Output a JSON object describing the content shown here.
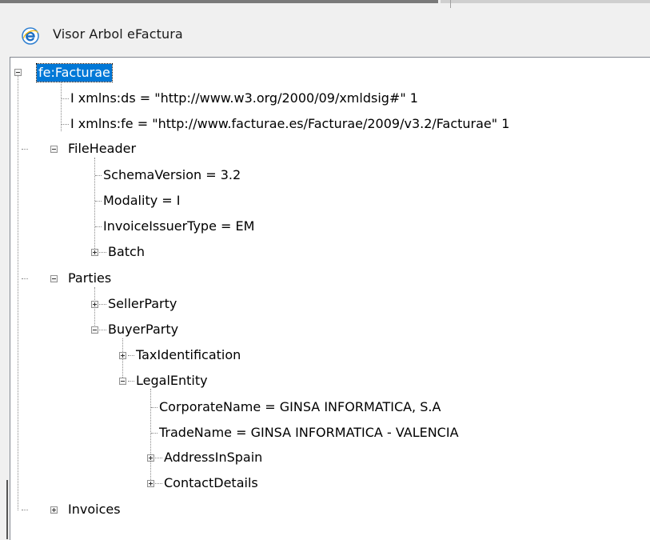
{
  "window": {
    "title": "Visor Arbol eFactura",
    "icon": "ie-e-icon",
    "accent": "#0078d7"
  },
  "tree": {
    "root": "fe:Facturae",
    "ns_ds": "I xmlns:ds = \"http://www.w3.org/2000/09/xmldsig#\" 1",
    "ns_fe": "I xmlns:fe = \"http://www.facturae.es/Facturae/2009/v3.2/Facturae\" 1",
    "fileheader": "FileHeader",
    "schema": "SchemaVersion = 3.2",
    "modality": "Modality = I",
    "issuer": "InvoiceIssuerType = EM",
    "batch": "Batch",
    "parties": "Parties",
    "seller": "SellerParty",
    "buyer": "BuyerParty",
    "taxid": "TaxIdentification",
    "legal": "LegalEntity",
    "corpname": "CorporateName = GINSA INFORMATICA, S.A",
    "tradename": "TradeName = GINSA INFORMATICA - VALENCIA",
    "address": "AddressInSpain",
    "contact": "ContactDetails",
    "invoices": "Invoices"
  }
}
